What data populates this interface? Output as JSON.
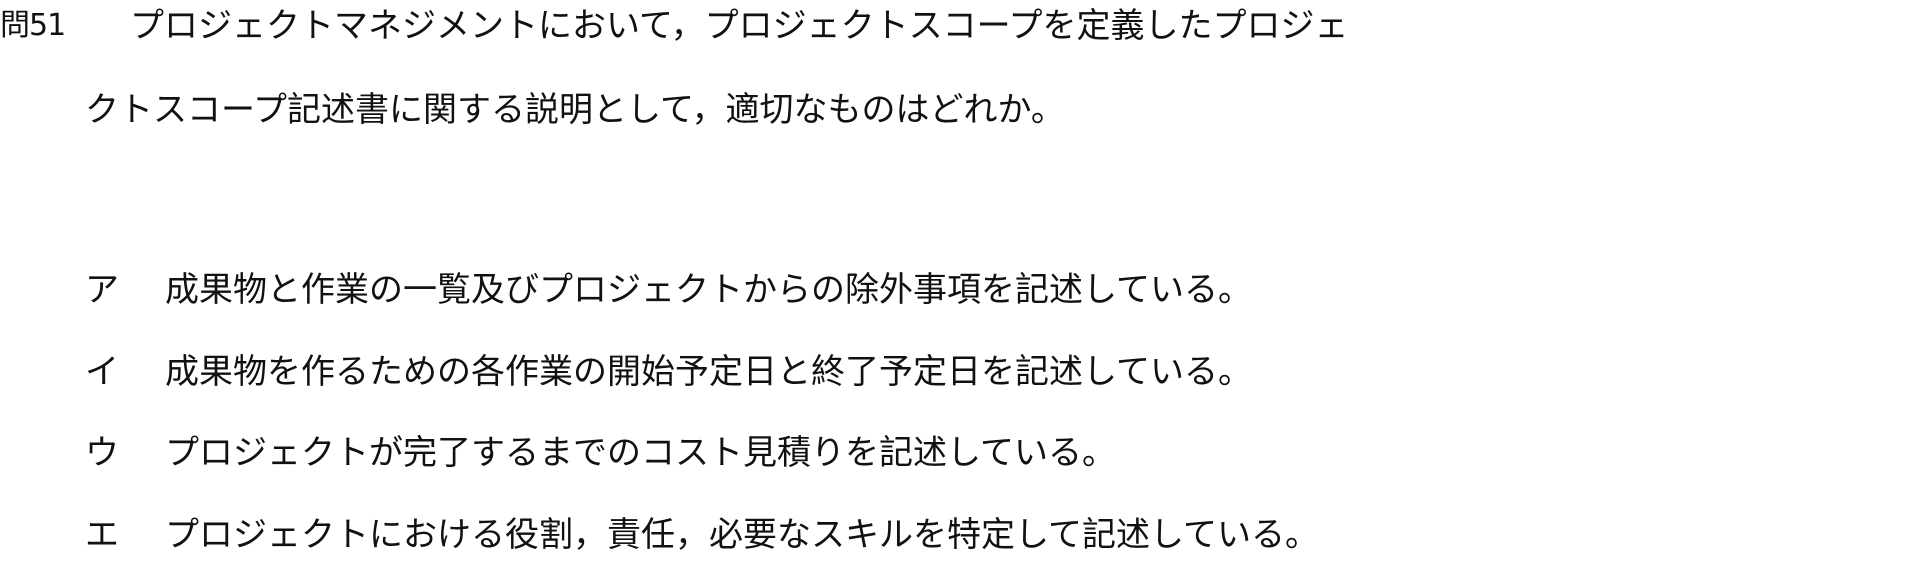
{
  "question": {
    "number": "問51",
    "line1": "プロジェクトマネジメントにおいて，プロジェクトスコープを定義したプロジェ",
    "line2": "クトスコープ記述書に関する説明として，適切なものはどれか。"
  },
  "choices": [
    {
      "mark": "ア",
      "text": "成果物と作業の一覧及びプロジェクトからの除外事項を記述している。"
    },
    {
      "mark": "イ",
      "text": "成果物を作るための各作業の開始予定日と終了予定日を記述している。"
    },
    {
      "mark": "ウ",
      "text": "プロジェクトが完了するまでのコスト見積りを記述している。"
    },
    {
      "mark": "エ",
      "text": "プロジェクトにおける役割，責任，必要なスキルを特定して記述している。"
    }
  ]
}
